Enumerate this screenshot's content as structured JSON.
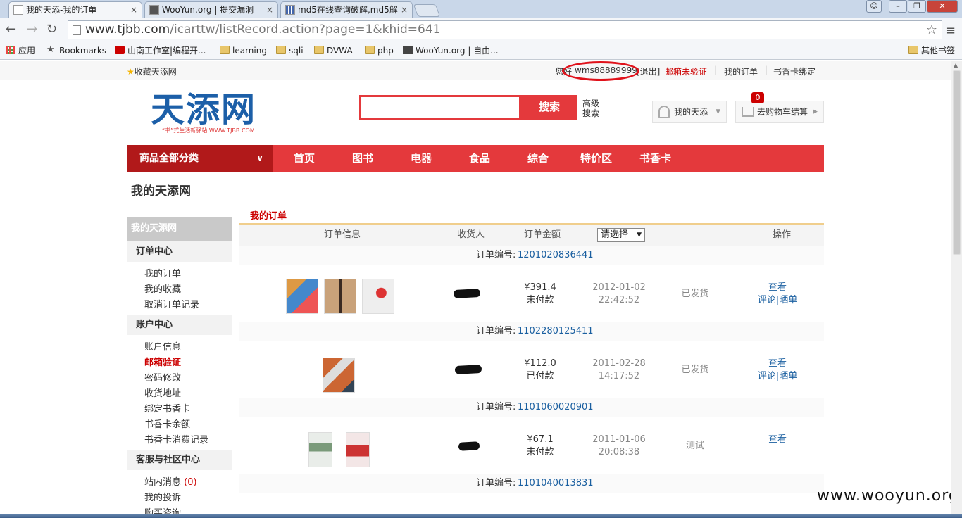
{
  "browser": {
    "tabs": [
      {
        "title": "我的天添-我的订单",
        "active": true
      },
      {
        "title": "WooYun.org | 提交漏洞",
        "active": false
      },
      {
        "title": "md5在线查询破解,md5解",
        "active": false
      }
    ],
    "tab_close": "×",
    "url_host": "www.tjbb.com",
    "url_path": "/icarttw/listRecord.action?page=1&khid=641",
    "bookmarks": [
      "应用",
      "Bookmarks",
      "山南工作室|编程开...",
      "learning",
      "sqli",
      "DVWA",
      "php",
      "WooYun.org | 自由...",
      "其他书签"
    ]
  },
  "topbar": {
    "favorite": "收藏天添网",
    "greeting": "您好",
    "username": "wms88889999",
    "logout": "[退出]",
    "email_unverified": "邮箱未验证",
    "my_orders": "我的订单",
    "bind_card": "书香卡绑定"
  },
  "header": {
    "logo_text": "天添网",
    "logo_tagline": "“书”式生活新驿站  WWW.TJBB.COM",
    "search_button": "搜索",
    "advanced_search": "高级搜索",
    "my_account": "我的天添",
    "cart_label": "去购物车结算",
    "cart_count": "0"
  },
  "nav": {
    "all_categories": "商品全部分类",
    "items": [
      "首页",
      "图书",
      "电器",
      "食品",
      "综合",
      "特价区",
      "书香卡"
    ]
  },
  "page_title": "我的天添网",
  "sidebar": {
    "head": "我的天添网",
    "sections": [
      {
        "title": "订单中心",
        "links": [
          "我的订单",
          "我的收藏",
          "取消订单记录"
        ]
      },
      {
        "title": "账户中心",
        "links": [
          "账户信息",
          "邮箱验证",
          "密码修改",
          "收货地址",
          "绑定书香卡",
          "书香卡余额",
          "书香卡消费记录"
        ]
      },
      {
        "title": "客服与社区中心",
        "links": [
          "站内消息",
          "我的投诉",
          "购买咨询"
        ]
      }
    ],
    "message_count": "(0)"
  },
  "orders": {
    "title": "我的订单",
    "columns": {
      "info": "订单信息",
      "receiver": "收货人",
      "amount": "订单金额",
      "filter": "请选择",
      "action": "操作"
    },
    "order_no_label": "订单编号:",
    "list": [
      {
        "no": "1201020836441",
        "amount": "¥391.4",
        "pay": "未付款",
        "date": "2012-01-02",
        "time": "22:42:52",
        "status": "已发货",
        "actions": [
          "查看",
          "评论",
          "晒单"
        ]
      },
      {
        "no": "1102280125411",
        "amount": "¥112.0",
        "pay": "已付款",
        "date": "2011-02-28",
        "time": "14:17:52",
        "status": "已发货",
        "actions": [
          "查看",
          "评论",
          "晒单"
        ]
      },
      {
        "no": "1101060020901",
        "amount": "¥67.1",
        "pay": "未付款",
        "date": "2011-01-06",
        "time": "20:08:38",
        "status": "测试",
        "actions": [
          "查看"
        ]
      },
      {
        "no": "1101040013831"
      }
    ]
  },
  "watermark": "www.wooyun.org",
  "colors": {
    "brand_red": "#e4393c",
    "dark_red": "#b1191a",
    "link_blue": "#1a5fa0",
    "annotation_red": "#e0121b"
  }
}
